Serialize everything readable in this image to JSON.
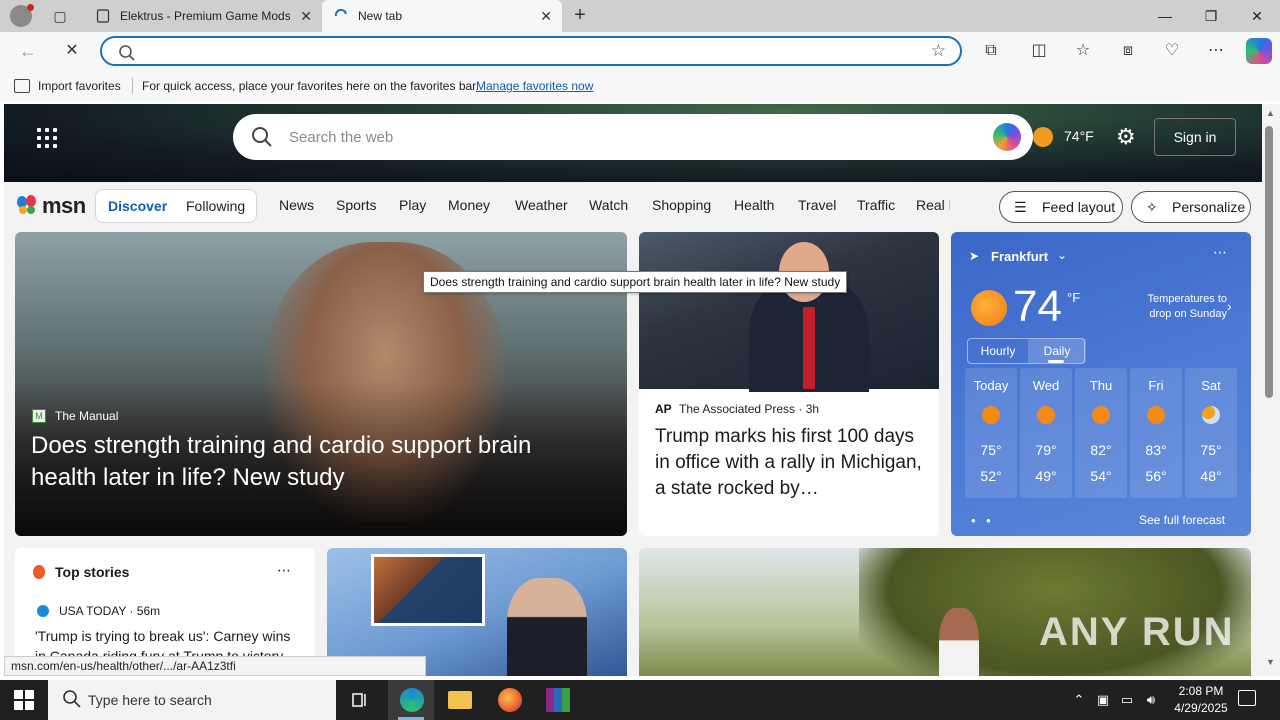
{
  "browser": {
    "tabs": [
      {
        "label": "Elektrus - Premium Game Mods |",
        "active": false
      },
      {
        "label": "New tab",
        "active": true
      }
    ],
    "address": {
      "value": "",
      "placeholder": ""
    },
    "favorites_bar": {
      "import_label": "Import favorites",
      "message": "For quick access, place your favorites here on the favorites bar.",
      "manage_link": "Manage favorites now"
    }
  },
  "msn": {
    "search_placeholder": "Search the web",
    "hero_temp": "74°F",
    "sign_in": "Sign in",
    "logo": "msn",
    "pill": {
      "discover": "Discover",
      "following": "Following"
    },
    "categories": [
      "News",
      "Sports",
      "Play",
      "Money",
      "Weather",
      "Watch",
      "Shopping",
      "Health",
      "Travel",
      "Traffic",
      "Real E"
    ],
    "feed_layout": "Feed layout",
    "personalize": "Personalize"
  },
  "cards": {
    "hero": {
      "source": "The Manual",
      "headline": "Does strength training and cardio support brain health later in life? New study"
    },
    "trump": {
      "source_badge": "AP",
      "source": "The Associated Press · 3h",
      "headline": "Trump marks his first 100 days in office with a rally in Michigan, a state rocked by…"
    },
    "weather": {
      "location": "Frankfurt",
      "temp": "74",
      "unit": "°F",
      "note": "Temperatures to drop on Sunday",
      "toggle_hourly": "Hourly",
      "toggle_daily": "Daily",
      "days": [
        {
          "name": "Today",
          "hi": "75°",
          "lo": "52°",
          "icon": "sun"
        },
        {
          "name": "Wed",
          "hi": "79°",
          "lo": "49°",
          "icon": "sun"
        },
        {
          "name": "Thu",
          "hi": "82°",
          "lo": "54°",
          "icon": "sun"
        },
        {
          "name": "Fri",
          "hi": "83°",
          "lo": "56°",
          "icon": "sun"
        },
        {
          "name": "Sat",
          "hi": "75°",
          "lo": "48°",
          "icon": "partly-cloudy"
        }
      ],
      "full_forecast": "See full forecast"
    },
    "top_stories": {
      "title": "Top stories",
      "source": "USA TODAY · 56m",
      "headline": "'Trump is trying to break us': Carney wins in Canada riding fury at Trump to victory"
    },
    "watermark": "ANY RUN"
  },
  "tooltip": "Does strength training and cardio support brain health later in life? New study",
  "status_url": "msn.com/en-us/health/other/.../ar-AA1z3tfi",
  "taskbar": {
    "search_placeholder": "Type here to search",
    "time": "2:08 PM",
    "date": "4/29/2025"
  }
}
